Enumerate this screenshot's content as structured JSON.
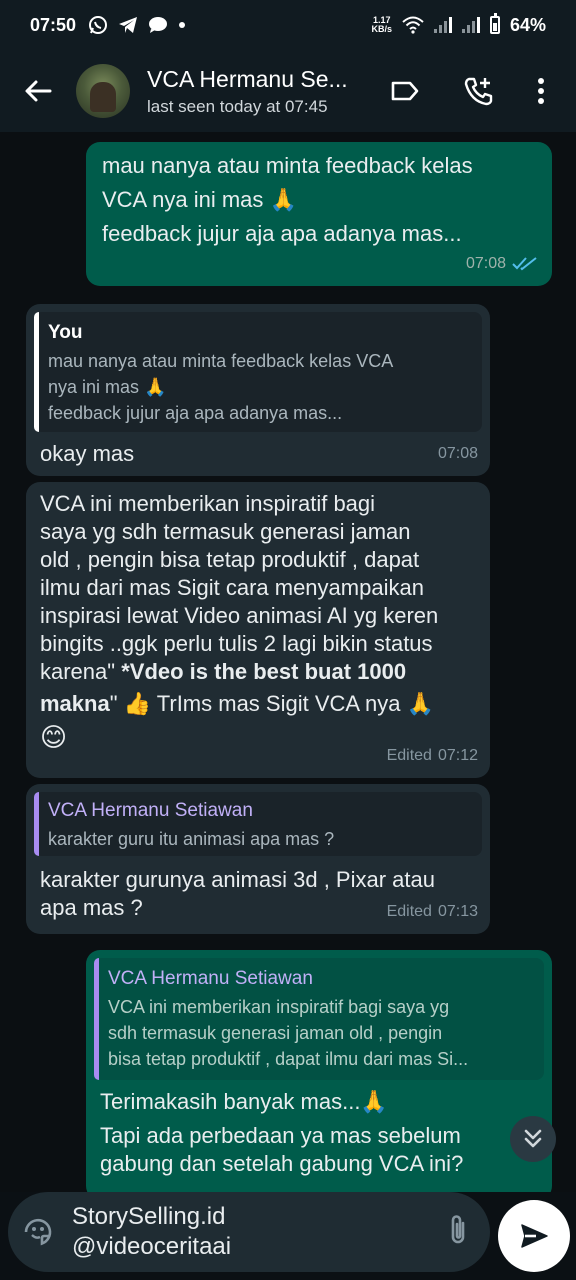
{
  "status_bar": {
    "time": "07:50",
    "net_speed_value": "1.17",
    "net_speed_unit": "KB/s",
    "battery": "64%",
    "notification_icons": [
      "whatsapp-icon",
      "telegram-icon",
      "chat-bubble-icon",
      "dot-icon"
    ]
  },
  "header": {
    "contact_name": "VCA Hermanu Se...",
    "last_seen": "last seen today at 07:45",
    "icons": [
      "back-arrow-icon",
      "label-icon",
      "add-call-icon",
      "more-vert-icon"
    ]
  },
  "messages": [
    {
      "direction": "out",
      "lines": [
        "mau nanya atau minta feedback kelas",
        "VCA nya ini mas 🙏",
        "feedback jujur aja apa adanya mas..."
      ],
      "time": "07:08",
      "status": "read"
    },
    {
      "direction": "in",
      "reply": {
        "author": "You",
        "lines": [
          "mau nanya atau minta feedback kelas VCA",
          "nya ini mas 🙏",
          "feedback jujur aja apa adanya mas..."
        ]
      },
      "text": "okay mas",
      "time": "07:08"
    },
    {
      "direction": "in",
      "lines": [
        "VCA ini  memberikan inspiratif bagi",
        "saya yg sdh termasuk generasi jaman",
        "old , pengin bisa tetap produktif , dapat",
        "ilmu dari mas Sigit cara menyampaikan",
        "inspirasi lewat Video animasi AI yg keren",
        "bingits ..ggk perlu tulis 2 lagi bikin status"
      ],
      "line7_prefix": "karena\" ",
      "line7_bold": "*Vdeo is the best buat 1000",
      "line8_bold": "makna",
      "line8_suffix": "\" 👍 TrIms mas Sigit VCA nya  🙏",
      "line9": "😊",
      "edited": "Edited",
      "time": "07:12"
    },
    {
      "direction": "in",
      "reply": {
        "author": "VCA Hermanu Setiawan",
        "lines": [
          "karakter guru itu animasi apa mas ?"
        ]
      },
      "lines": [
        "karakter gurunya animasi 3d , Pixar atau",
        "apa mas ?"
      ],
      "edited": "Edited",
      "time": "07:13"
    },
    {
      "direction": "out",
      "reply": {
        "author": "VCA Hermanu Setiawan",
        "lines": [
          "VCA ini  memberikan inspiratif bagi saya yg",
          "sdh termasuk generasi jaman old , pengin",
          "bisa tetap produktif , dapat ilmu dari mas Si..."
        ]
      },
      "lines": [
        "Terimakasih banyak mas...🙏",
        "Tapi ada perbedaan ya mas sebelum",
        "gabung dan setelah gabung VCA ini?"
      ]
    }
  ],
  "input": {
    "lines": [
      "StorySelling.id",
      "@videoceritaai"
    ]
  }
}
